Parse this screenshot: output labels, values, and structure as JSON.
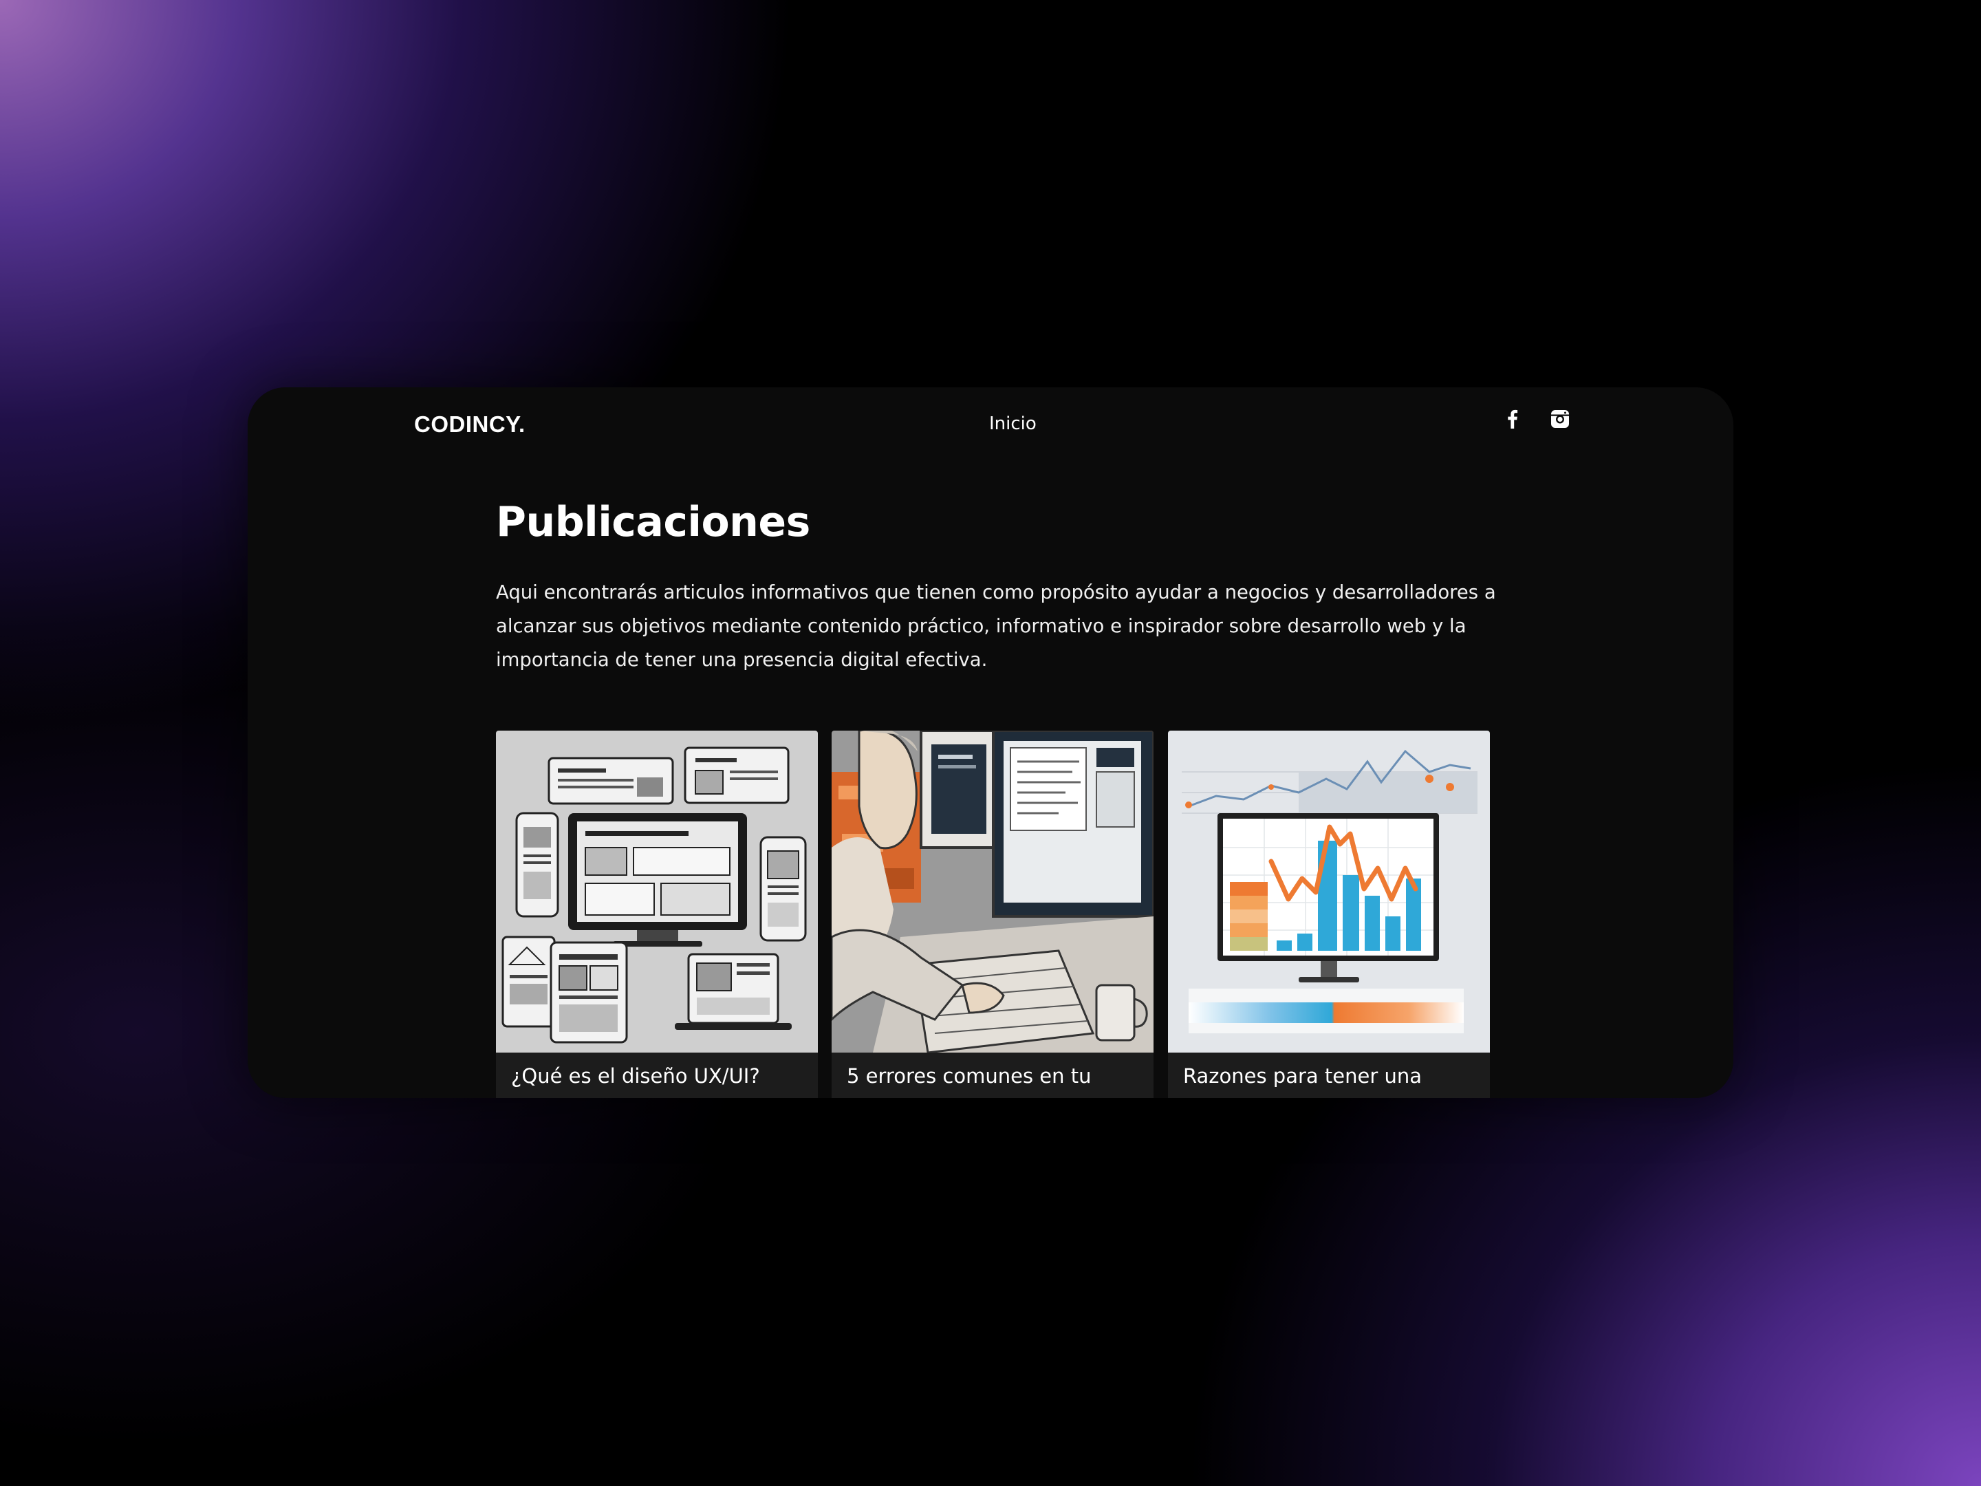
{
  "header": {
    "logo": "CODINCY.",
    "nav_link": "Inicio",
    "social_icons": [
      "facebook-icon",
      "instagram-icon"
    ]
  },
  "main": {
    "title": "Publicaciones",
    "intro": "Aqui encontrarás articulos informativos que tienen como propósito ayudar a negocios y desarrolladores a alcanzar sus objetivos mediante contenido práctico, informativo e inspirador sobre desarrollo web y la importancia de tener una presencia digital efectiva."
  },
  "posts": [
    {
      "title": "¿Qué es el diseño UX/UI?",
      "image": "ux-ui-devices-illustration"
    },
    {
      "title": "5 errores comunes en tu",
      "image": "developer-at-computer-illustration"
    },
    {
      "title": "Razones para tener una",
      "image": "analytics-chart-monitor-illustration"
    }
  ],
  "colors": {
    "window_bg": "#0b0b0b",
    "card_bg": "#1c1c1c",
    "text": "#ffffff",
    "accent_orange": "#ee7a32",
    "accent_blue": "#2fa8d8"
  }
}
